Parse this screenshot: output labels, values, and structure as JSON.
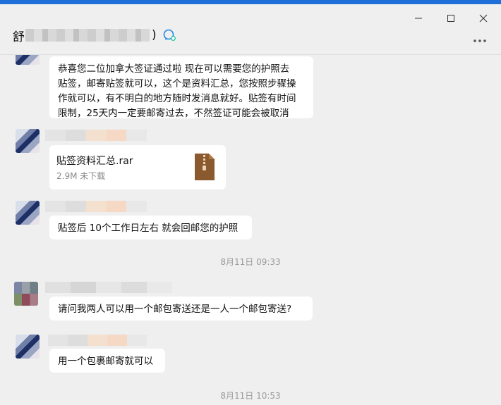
{
  "window": {
    "minimize_icon": "minimize-icon",
    "maximize_icon": "maximize-icon",
    "close_icon": "close-icon",
    "accent_color": "#1e6fd9"
  },
  "header": {
    "title_prefix": "舒",
    "title_suffix": ")",
    "chat_icon": "chat-bubble-icon",
    "more_icon": "more-dots-icon"
  },
  "messages": [
    {
      "sender": "other",
      "lines": [
        "恭喜您二位加拿大签证通过啦 现在可以需要您的护照去",
        "贴签，邮寄贴签就可以，这个是资料汇总，您按照步骤操",
        "作就可以，有不明白的地方随时发消息就好。贴签有时间",
        "限制，25天内一定要邮寄过去，不然签证可能会被取消"
      ]
    },
    {
      "sender": "other",
      "type": "file",
      "file_name": "贴签资料汇总.rar",
      "file_meta": "2.9M 未下载",
      "file_icon": "zip-archive-icon"
    },
    {
      "sender": "other",
      "text": "贴签后 10个工作日左右 就会回邮您的护照"
    },
    {
      "type": "timestamp",
      "text": "8月11日 09:33"
    },
    {
      "sender": "customer",
      "text": "请问我两人可以用一个邮包寄送还是一人一个邮包寄送?"
    },
    {
      "sender": "other",
      "text": "用一个包裹邮寄就可以"
    },
    {
      "type": "timestamp",
      "text": "8月11日 10:53"
    }
  ]
}
